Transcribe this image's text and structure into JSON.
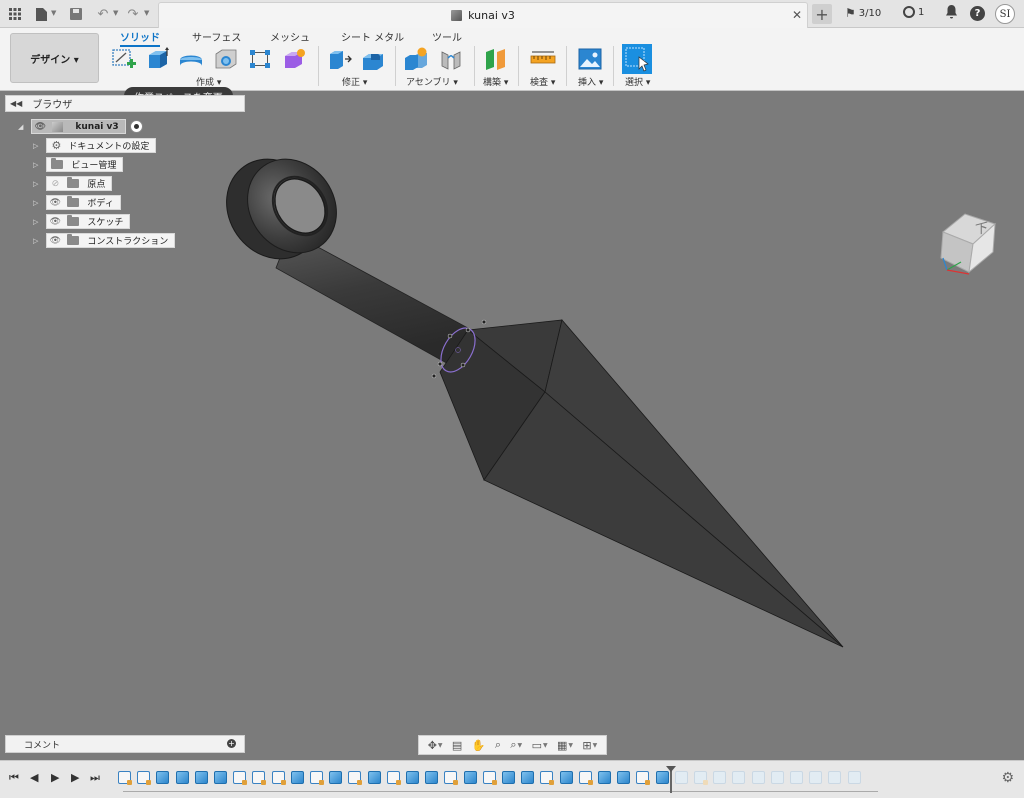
{
  "app": {
    "document_title": "kunai v3",
    "job_status": "3/10",
    "notifications": "1",
    "user_initials": "SI"
  },
  "ribbon": {
    "workspace": "デザイン ▾",
    "tabs": [
      {
        "label": "ソリッド",
        "active": true
      },
      {
        "label": "サーフェス",
        "active": false
      },
      {
        "label": "メッシュ",
        "active": false
      },
      {
        "label": "シート メタル",
        "active": false
      },
      {
        "label": "ツール",
        "active": false
      }
    ],
    "groups": [
      {
        "label": "作成 ▾"
      },
      {
        "label": "修正 ▾"
      },
      {
        "label": "アセンブリ ▾"
      },
      {
        "label": "構築 ▾"
      },
      {
        "label": "検査 ▾"
      },
      {
        "label": "挿入 ▾"
      },
      {
        "label": "選択 ▾"
      }
    ]
  },
  "tooltip": "作業スペースを変更",
  "browser": {
    "title": "ブラウザ",
    "root": "kunai v3",
    "items": [
      {
        "label": "ドキュメントの設定",
        "icon": "gear-icon"
      },
      {
        "label": "ビュー管理",
        "icon": "folder-icon"
      },
      {
        "label": "原点",
        "icon": "folder-icon",
        "hidden": true
      },
      {
        "label": "ボディ",
        "icon": "folder-icon"
      },
      {
        "label": "スケッチ",
        "icon": "folder-icon"
      },
      {
        "label": "コンストラクション",
        "icon": "folder-icon"
      }
    ]
  },
  "comments": {
    "label": "コメント"
  },
  "viewcube": {
    "face_label": "下"
  },
  "colors": {
    "accent": "#0d74c7",
    "viewport_bg": "#7b7b7b",
    "model": "#3c3c3c"
  }
}
